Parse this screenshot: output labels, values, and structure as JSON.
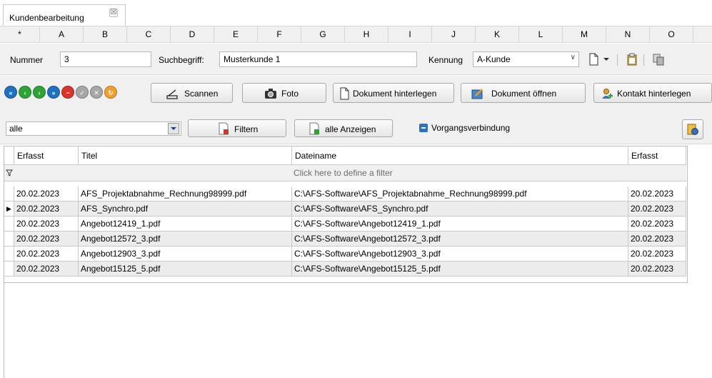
{
  "tab": {
    "label": "Kundenbearbeitung",
    "close_glyph": "☒"
  },
  "letters": [
    "*",
    "A",
    "B",
    "C",
    "D",
    "E",
    "F",
    "G",
    "H",
    "I",
    "J",
    "K",
    "L",
    "M",
    "N",
    "O"
  ],
  "fields": {
    "nummer_label": "Nummer",
    "nummer_value": "3",
    "suchbegriff_label": "Suchbegriff:",
    "suchbegriff_value": "Musterkunde 1",
    "kennung_label": "Kennung",
    "kennung_value": "A-Kunde"
  },
  "buttons": {
    "scannen": "Scannen",
    "foto": "Foto",
    "dokument_hinterlegen": "Dokument hinterlegen",
    "dokument_oeffnen": "Dokument öffnen",
    "kontakt_hinterlegen": "Kontakt hinterlegen"
  },
  "nav_icons": [
    {
      "name": "first-record-icon",
      "color": "#1f6fc2"
    },
    {
      "name": "previous-record-icon",
      "color": "#2fa336"
    },
    {
      "name": "next-record-icon",
      "color": "#2fa336"
    },
    {
      "name": "last-record-icon",
      "color": "#1f6fc2"
    },
    {
      "name": "delete-record-icon",
      "color": "#d9342b"
    },
    {
      "name": "save-record-icon",
      "color": "#a7a7a7"
    },
    {
      "name": "cancel-record-icon",
      "color": "#a7a7a7"
    },
    {
      "name": "refresh-record-icon",
      "color": "#f0a030"
    }
  ],
  "filter": {
    "select_value": "alle",
    "filter_button": "Filtern",
    "show_all_button": "alle Anzeigen",
    "vorgang_label": "Vorgangsverbindung",
    "define_filter_text": "Click here to define a filter"
  },
  "table": {
    "columns": [
      "Erfasst",
      "Titel",
      "Dateiname",
      "Erfasst"
    ],
    "rows": [
      [
        "20.02.2023",
        "AFS_Projektabnahme_Rechnung98999.pdf",
        "C:\\AFS-Software\\AFS_Projektabnahme_Rechnung98999.pdf",
        "20.02.2023"
      ],
      [
        "20.02.2023",
        "AFS_Synchro.pdf",
        "C:\\AFS-Software\\AFS_Synchro.pdf",
        "20.02.2023"
      ],
      [
        "20.02.2023",
        "Angebot12419_1.pdf",
        "C:\\AFS-Software\\Angebot12419_1.pdf",
        "20.02.2023"
      ],
      [
        "20.02.2023",
        "Angebot12572_3.pdf",
        "C:\\AFS-Software\\Angebot12572_3.pdf",
        "20.02.2023"
      ],
      [
        "20.02.2023",
        "Angebot12903_3.pdf",
        "C:\\AFS-Software\\Angebot12903_3.pdf",
        "20.02.2023"
      ],
      [
        "20.02.2023",
        "Angebot15125_5.pdf",
        "C:\\AFS-Software\\Angebot15125_5.pdf",
        "20.02.2023"
      ]
    ],
    "selected_row": 1
  },
  "colors": {
    "panel_bg": "#f0f0f0",
    "alt_row": "#ececec",
    "selection_blue": "#2b72c7"
  }
}
